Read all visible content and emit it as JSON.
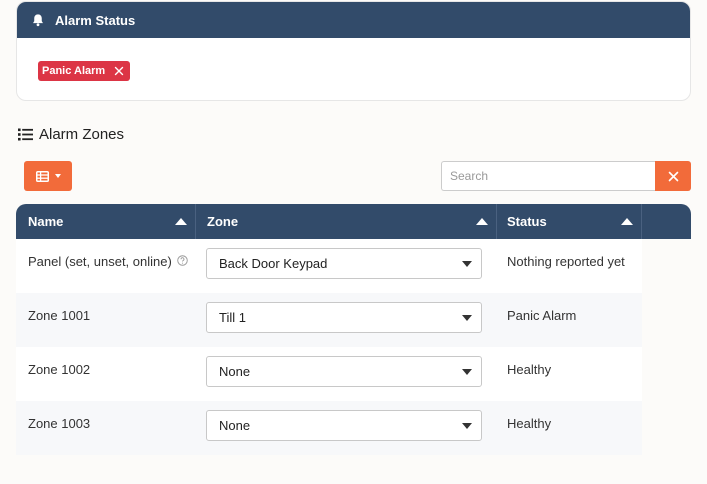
{
  "alarm_status": {
    "title": "Alarm Status",
    "icon": "bell-icon",
    "active_alarms": [
      {
        "label": "Panic Alarm",
        "color": "#dc3545"
      }
    ]
  },
  "alarm_zones": {
    "title": "Alarm Zones",
    "icon": "list-icon",
    "search": {
      "placeholder": "Search",
      "value": ""
    },
    "accent_color": "#f26b3a",
    "header_color": "#324b6a",
    "columns": [
      "Name",
      "Zone",
      "Status"
    ],
    "rows": [
      {
        "name": "Panel (set, unset, online)",
        "has_help": true,
        "zone": "Back Door Keypad",
        "status": "Nothing reported yet"
      },
      {
        "name": "Zone 1001",
        "zone": "Till 1",
        "status": "Panic Alarm"
      },
      {
        "name": "Zone 1002",
        "zone": "None",
        "status": "Healthy"
      },
      {
        "name": "Zone 1003",
        "zone": "None",
        "status": "Healthy"
      }
    ]
  }
}
